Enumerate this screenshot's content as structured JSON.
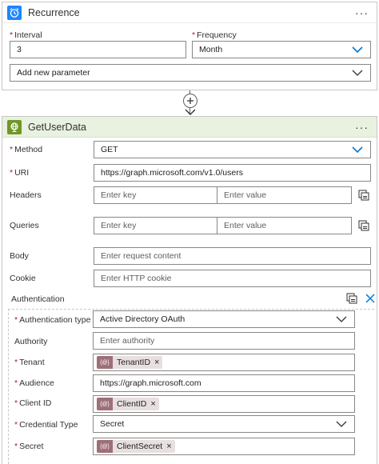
{
  "colors": {
    "recurrence_accent": "#1f85ff",
    "http_accent": "#709727",
    "token_accent": "#9e6f78",
    "required": "#a4262c",
    "dropdown_chevron": "#0078d4"
  },
  "recurrence": {
    "title": "Recurrence",
    "icon": "alarm-clock-icon",
    "more": "···",
    "interval_label": "Interval",
    "interval_value": "3",
    "frequency_label": "Frequency",
    "frequency_value": "Month",
    "add_parameter": "Add new parameter"
  },
  "connector": {
    "icon": "plus-circle-icon"
  },
  "action": {
    "title": "GetUserData",
    "icon": "globe-icon",
    "more": "···",
    "method_label": "Method",
    "method_value": "GET",
    "uri_label": "URI",
    "uri_value": "https://graph.microsoft.com/v1.0/users",
    "headers_label": "Headers",
    "headers_key_placeholder": "Enter key",
    "headers_value_placeholder": "Enter value",
    "queries_label": "Queries",
    "queries_key_placeholder": "Enter key",
    "queries_value_placeholder": "Enter value",
    "body_label": "Body",
    "body_placeholder": "Enter request content",
    "cookie_label": "Cookie",
    "cookie_placeholder": "Enter HTTP cookie",
    "auth_label": "Authentication",
    "auth": {
      "type_label": "Authentication type",
      "type_value": "Active Directory OAuth",
      "authority_label": "Authority",
      "authority_placeholder": "Enter authority",
      "tenant_label": "Tenant",
      "tenant_token": "TenantID",
      "audience_label": "Audience",
      "audience_value": "https://graph.microsoft.com",
      "client_id_label": "Client ID",
      "client_id_token": "ClientID",
      "credential_type_label": "Credential Type",
      "credential_type_value": "Secret",
      "secret_label": "Secret",
      "secret_token": "ClientSecret"
    }
  }
}
